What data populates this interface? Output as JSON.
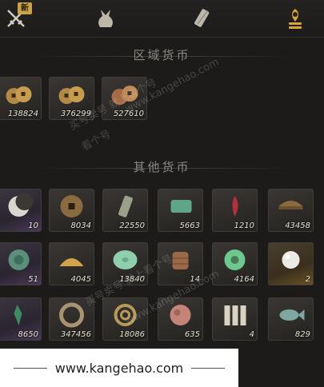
{
  "tabs": {
    "badge": "新",
    "items": [
      {
        "icon": "crossed-swords-icon"
      },
      {
        "icon": "pouch-icon"
      },
      {
        "icon": "scroll-icon"
      },
      {
        "icon": "currency-icon",
        "active": true
      }
    ]
  },
  "regional": {
    "title": "区域货币",
    "items": [
      {
        "icon": "coin-pile-icon",
        "count": "138824"
      },
      {
        "icon": "coin-pile-icon",
        "count": "376299"
      },
      {
        "icon": "copper-coins-icon",
        "count": "527610"
      }
    ]
  },
  "other": {
    "title": "其他货币",
    "items": [
      {
        "icon": "crescent-icon",
        "count": "10"
      },
      {
        "icon": "ancient-coin-icon",
        "count": "8034"
      },
      {
        "icon": "token-tablet-icon",
        "count": "22550"
      },
      {
        "icon": "jade-slip-icon",
        "count": "5663"
      },
      {
        "icon": "red-feather-icon",
        "count": "1210"
      },
      {
        "icon": "bronze-bowl-icon",
        "count": "43458"
      },
      {
        "icon": "jade-stone-icon",
        "count": "51"
      },
      {
        "icon": "grain-icon",
        "count": "4045"
      },
      {
        "icon": "jade-disc-icon",
        "count": "13840"
      },
      {
        "icon": "basket-icon",
        "count": "14"
      },
      {
        "icon": "jade-ring-icon",
        "count": "4164"
      },
      {
        "icon": "pearl-icon",
        "count": "2"
      },
      {
        "icon": "green-shard-icon",
        "count": "8650"
      },
      {
        "icon": "coiled-rope-icon",
        "count": "347456"
      },
      {
        "icon": "brass-coil-icon",
        "count": "18086"
      },
      {
        "icon": "pink-stone-icon",
        "count": "635"
      },
      {
        "icon": "bone-tablets-icon",
        "count": "4"
      },
      {
        "icon": "fish-icon",
        "count": "829"
      }
    ]
  },
  "watermark": {
    "lines": [
      "买号卖号 就上看个号",
      "www.kangehao.com",
      "看个号"
    ]
  },
  "footer": {
    "url": "www.kangehao.com"
  },
  "colors": {
    "accent": "#d9a53a",
    "badge": "#c9a24a"
  }
}
